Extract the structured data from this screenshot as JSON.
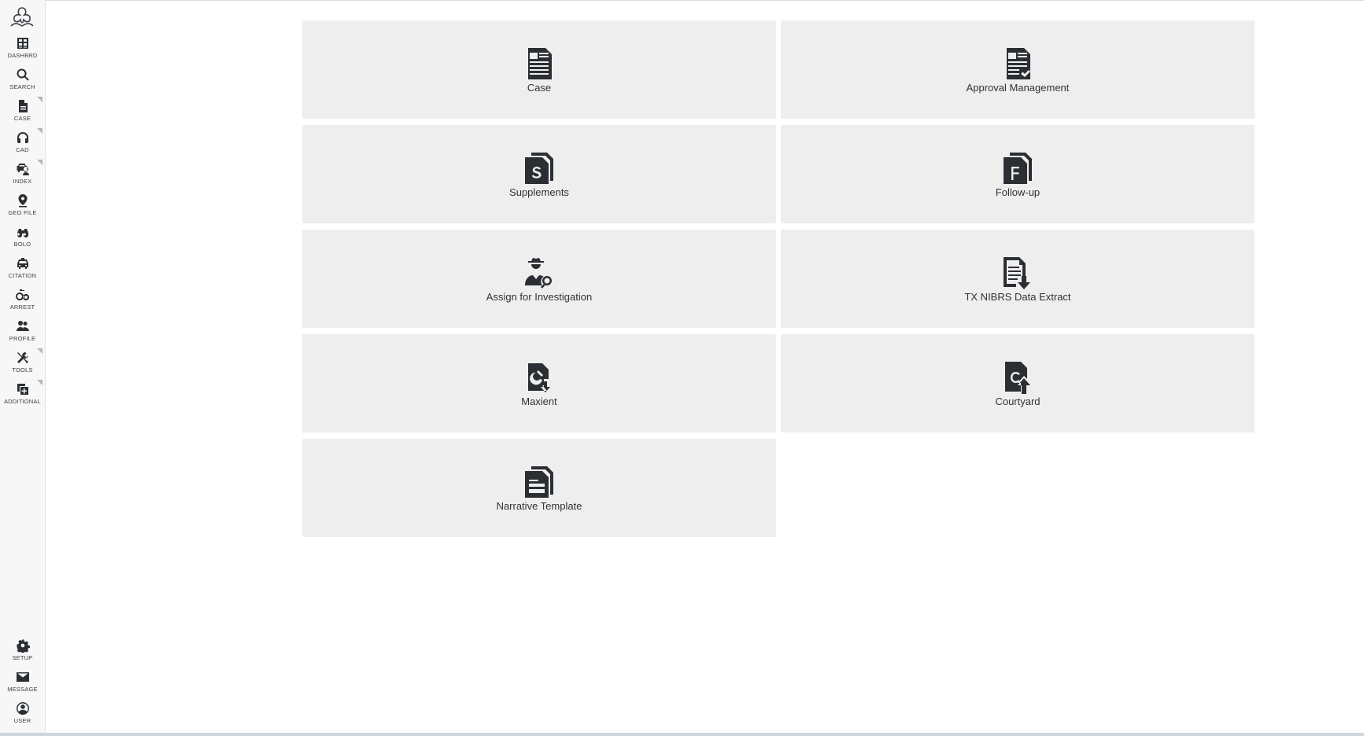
{
  "sidebar": {
    "top_items": [
      {
        "label": "DASHBRD",
        "icon": "dashboard-grid-icon"
      },
      {
        "label": "SEARCH",
        "icon": "search-icon"
      },
      {
        "label": "CASE",
        "icon": "document-icon"
      },
      {
        "label": "CAD",
        "icon": "headset-icon"
      },
      {
        "label": "INDEX",
        "icon": "vehicle-person-icon"
      },
      {
        "label": "GEO FILE",
        "icon": "map-pin-icon"
      },
      {
        "label": "BOLO",
        "icon": "binoculars-icon"
      },
      {
        "label": "CITATION",
        "icon": "car-icon"
      },
      {
        "label": "ARREST",
        "icon": "handcuffs-icon"
      },
      {
        "label": "PROFILE",
        "icon": "people-icon"
      },
      {
        "label": "TOOLS",
        "icon": "tools-icon"
      },
      {
        "label": "ADDITIONAL",
        "icon": "add-copy-icon"
      }
    ],
    "bottom_items": [
      {
        "label": "SETUP",
        "icon": "gear-icon"
      },
      {
        "label": "MESSAGE",
        "icon": "envelope-icon"
      },
      {
        "label": "USER",
        "icon": "user-circle-icon"
      }
    ]
  },
  "tiles": [
    {
      "label": "Case",
      "icon": "case-document-icon"
    },
    {
      "label": "Approval Management",
      "icon": "approval-document-icon"
    },
    {
      "label": "Supplements",
      "icon": "supplements-s-icon"
    },
    {
      "label": "Follow-up",
      "icon": "follow-up-f-icon"
    },
    {
      "label": "Assign for Investigation",
      "icon": "detective-search-icon"
    },
    {
      "label": "TX NIBRS Data Extract",
      "icon": "data-extract-download-icon"
    },
    {
      "label": "Maxient",
      "icon": "maxient-download-icon"
    },
    {
      "label": "Courtyard",
      "icon": "courtyard-upload-icon"
    },
    {
      "label": "Narrative Template",
      "icon": "narrative-template-icon"
    }
  ],
  "colors": {
    "sidebar_bg": "#f7f7f7",
    "tile_bg": "#eeeeee",
    "icon": "#2b2f33"
  }
}
